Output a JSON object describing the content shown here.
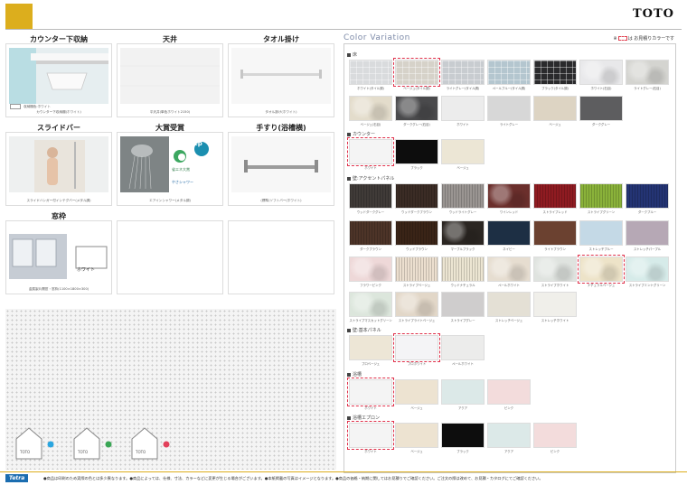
{
  "header": {
    "brand": "TOTO"
  },
  "products": [
    {
      "title": "カウンター下収納",
      "caption": "カウンター下収納棚(ホワイト)",
      "sub": "収納棚色:ホワイト"
    },
    {
      "title": "天井",
      "caption": "平天井(単色ホワイト2150)"
    },
    {
      "title": "タオル掛け",
      "caption": "タオル掛け(ホワイト)"
    },
    {
      "title": "スライドバー",
      "caption": "スライドハンガー付インテグバー(メタル調)"
    },
    {
      "title": "大賞受賞",
      "caption": "エアインシャワー(メタル調)",
      "badge_word": "ep",
      "badge_sub": "省エネ大賞",
      "badge_foot": "やさシャワー"
    },
    {
      "title": "手すり(浴槽横)",
      "caption": "(標準)ソフトバー(ホワイト)"
    },
    {
      "title": "窓枠",
      "caption": "金属製片開窓・窓枠(1100×1800×300)",
      "window_label": "ホワイト"
    }
  ],
  "color_variation": {
    "title": "Color Variation",
    "note_prefix": "※",
    "note_suffix": "は お見積りカラーです",
    "sections": [
      {
        "title": "床",
        "swatches": [
          {
            "label": "ホワイト(タイル調)",
            "color": "#d9dbdd",
            "texture": "mosaic",
            "selected": false
          },
          {
            "label": "ベージュ(タイル調)",
            "color": "#d6d2c9",
            "texture": "mosaic",
            "selected": true
          },
          {
            "label": "ライトグレー(タイル調)",
            "color": "#c8ccd0",
            "texture": "mosaic",
            "selected": false
          },
          {
            "label": "ペールブルー(タイル調)",
            "color": "#b4c6cf",
            "texture": "mosaic",
            "selected": false
          },
          {
            "label": "ブラック(タイル調)",
            "color": "#2a2a2c",
            "texture": "mosaic",
            "selected": false
          },
          {
            "label": "ホワイト(石目)",
            "color": "#e8e8ea",
            "texture": "marble",
            "selected": false
          },
          {
            "label": "ライトグレー(石目)",
            "color": "#d4d4d0",
            "texture": "marble",
            "selected": false
          },
          {
            "label": "ベージュ(石目)",
            "color": "#e3dccb",
            "texture": "marble",
            "selected": false
          },
          {
            "label": "ダークグレー(石目)",
            "color": "#4a4a4c",
            "texture": "marble",
            "selected": false
          },
          {
            "label": "ホワイト",
            "color": "#ececec",
            "texture": "",
            "selected": false
          },
          {
            "label": "ライトグレー",
            "color": "#d7d7d7",
            "texture": "",
            "selected": false
          },
          {
            "label": "ベージュ",
            "color": "#ddd4c3",
            "texture": "",
            "selected": false
          },
          {
            "label": "ダークグレー",
            "color": "#5d5d5f",
            "texture": "",
            "selected": false
          }
        ]
      },
      {
        "title": "カウンター",
        "swatches": [
          {
            "label": "ホワイト",
            "color": "#f4f4f4",
            "texture": "",
            "selected": true
          },
          {
            "label": "ブラック",
            "color": "#0d0d0d",
            "texture": "",
            "selected": false
          },
          {
            "label": "ベージュ",
            "color": "#ece6d5",
            "texture": "",
            "selected": false
          }
        ]
      },
      {
        "title": "壁:アクセントパネル",
        "swatches": [
          {
            "label": "ウッドダークグレー",
            "color": "#403b38",
            "texture": "stripes-v",
            "selected": false
          },
          {
            "label": "ウッドダークブラウン",
            "color": "#3b2c25",
            "texture": "stripes-v",
            "selected": false
          },
          {
            "label": "ウッドライトグレー",
            "color": "#9a9592",
            "texture": "stripes-v",
            "selected": false
          },
          {
            "label": "ワインレッド",
            "color": "#6b2f2c",
            "texture": "marble",
            "selected": false
          },
          {
            "label": "ストライプレッド",
            "color": "#8f1b21",
            "texture": "stripes-v",
            "selected": false
          },
          {
            "label": "ストライプグリーン",
            "color": "#8ab23a",
            "texture": "stripes-v",
            "selected": false
          },
          {
            "label": "ダークブルー",
            "color": "#243474",
            "texture": "stripes-v",
            "selected": false
          },
          {
            "label": "ダークブラウン",
            "color": "#4d3428",
            "texture": "stripes-v",
            "selected": false
          },
          {
            "label": "ウッドブラウン",
            "color": "#3a2417",
            "texture": "stripes-v",
            "selected": false
          },
          {
            "label": "マーブルブラック",
            "color": "#2b2622",
            "texture": "marble",
            "selected": false
          },
          {
            "label": "ネイビー",
            "color": "#1d2f44",
            "texture": "",
            "selected": false
          },
          {
            "label": "ライトブラウン",
            "color": "#6b4130",
            "texture": "",
            "selected": false
          },
          {
            "label": "ストレッチブルー",
            "color": "#c4d9e6",
            "texture": "",
            "selected": false
          },
          {
            "label": "ストレッチパープル",
            "color": "#b6a8b5",
            "texture": "",
            "selected": false
          },
          {
            "label": "フラワーピンク",
            "color": "#eed8d8",
            "texture": "marble",
            "selected": false
          },
          {
            "label": "ストライプベージュ",
            "color": "#ecdfcf",
            "texture": "stripes-v",
            "selected": false
          },
          {
            "label": "ウッドナチュラル",
            "color": "#ece5d2",
            "texture": "stripes-v",
            "selected": false
          },
          {
            "label": "ペールホワイト",
            "color": "#e6ddd0",
            "texture": "marble",
            "selected": false
          },
          {
            "label": "ストライプホワイト",
            "color": "#dfe3df",
            "texture": "marble",
            "selected": false
          },
          {
            "label": "ナチュラルベージュ",
            "color": "#ede3c8",
            "texture": "marble",
            "selected": true
          },
          {
            "label": "ストライプミントグリーン",
            "color": "#d6ebe9",
            "texture": "marble",
            "selected": false
          },
          {
            "label": "ストライプマスカットグリーン",
            "color": "#dce6dc",
            "texture": "marble",
            "selected": false
          },
          {
            "label": "ストライプライトベージュ",
            "color": "#e2d7c8",
            "texture": "marble",
            "selected": false
          },
          {
            "label": "ストライプグレー",
            "color": "#cfcdcd",
            "texture": "",
            "selected": false
          },
          {
            "label": "ストレッチベージュ",
            "color": "#e4e0d5",
            "texture": "",
            "selected": false
          },
          {
            "label": "ストレッチホワイト",
            "color": "#f0efea",
            "texture": "",
            "selected": false
          }
        ]
      },
      {
        "title": "壁:基本パネル",
        "swatches": [
          {
            "label": "プロベージュ",
            "color": "#ede6d6",
            "texture": "",
            "selected": false
          },
          {
            "label": "プロホワイト",
            "color": "#f4f4f6",
            "texture": "",
            "selected": true
          },
          {
            "label": "ペールホワイト",
            "color": "#ececeb",
            "texture": "",
            "selected": false
          }
        ]
      },
      {
        "title": "浴槽",
        "swatches": [
          {
            "label": "ホワイト",
            "color": "#f4f4f4",
            "texture": "",
            "selected": true
          },
          {
            "label": "ベージュ",
            "color": "#ede3d1",
            "texture": "",
            "selected": false
          },
          {
            "label": "アクア",
            "color": "#dce9e8",
            "texture": "",
            "selected": false
          },
          {
            "label": "ピンク",
            "color": "#f3dcdc",
            "texture": "",
            "selected": false
          }
        ]
      },
      {
        "title": "浴槽エプロン",
        "swatches": [
          {
            "label": "ホワイト",
            "color": "#f4f4f4",
            "texture": "",
            "selected": true
          },
          {
            "label": "ベージュ",
            "color": "#ede3d1",
            "texture": "",
            "selected": false
          },
          {
            "label": "ブラック",
            "color": "#0d0d0d",
            "texture": "",
            "selected": false
          },
          {
            "label": "アクア",
            "color": "#dce9e8",
            "texture": "",
            "selected": false
          },
          {
            "label": "ピンク",
            "color": "#f3dcdc",
            "texture": "",
            "selected": false
          }
        ]
      }
    ]
  },
  "badges": [
    {
      "text": "TOTO",
      "dot_color": "#2aa6e0"
    },
    {
      "text": "TOTO",
      "dot_color": "#3aa655"
    },
    {
      "text": "TOTO",
      "dot_color": "#e2405a"
    }
  ],
  "footer": {
    "logo": "Tetra",
    "note": "●商品は印刷のため実際の色とは多少異なります。●商品によっては、仕様、寸法、カラーなどに変更が生じる場合がございます。●本紙掲載の写真はイメージとなります。●商品の価格・納期に関してはお見積りでご確認ください。ご注文の際は改めて、お見積・カタログにてご確認ください。"
  }
}
